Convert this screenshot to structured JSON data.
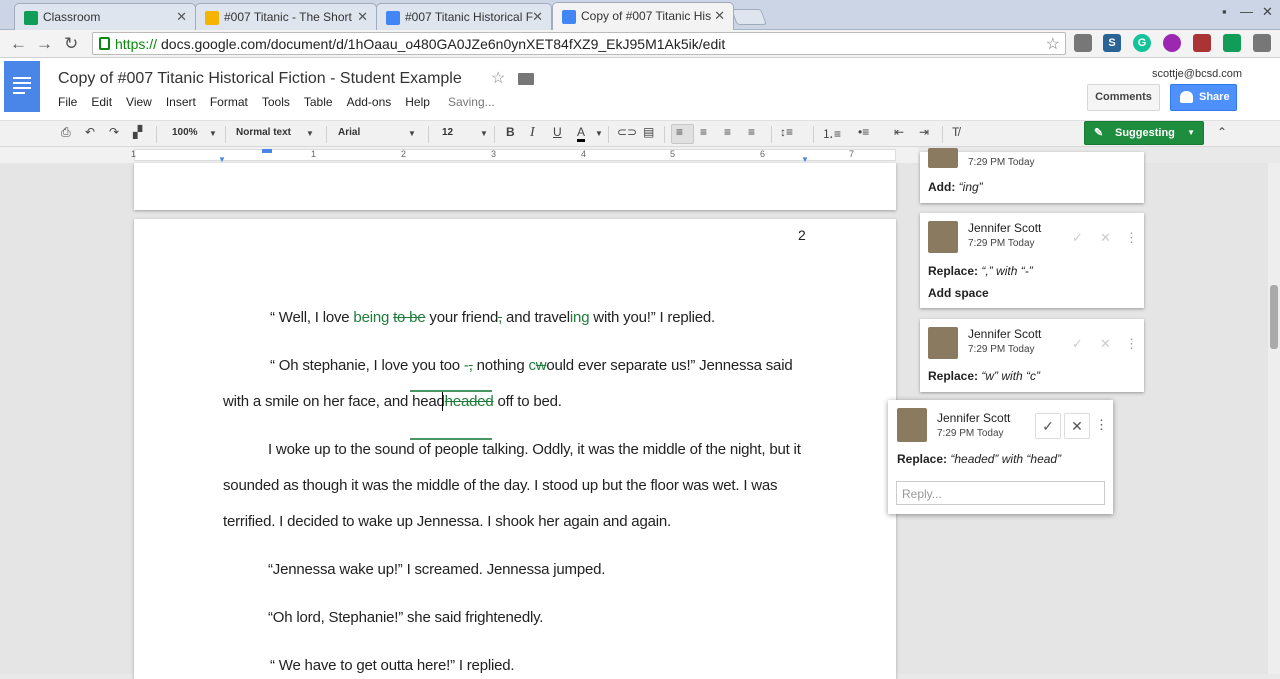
{
  "browser": {
    "tabs": [
      {
        "title": "Classroom",
        "icon": "classroom-icon",
        "color": "#0f9d58"
      },
      {
        "title": "#007 Titanic - The Short",
        "icon": "drive-icon",
        "color": "#f4b400"
      },
      {
        "title": "#007 Titanic Historical F",
        "icon": "docs-icon",
        "color": "#4285f4"
      },
      {
        "title": "Copy of #007 Titanic His",
        "icon": "docs-icon",
        "color": "#4285f4"
      }
    ],
    "url_scheme": "https://",
    "url_rest": "docs.google.com/document/d/1hOaau_o480GA0JZe6n0ynXET84fXZ9_EkJ95M1Ak5ik/edit",
    "extensions": [
      {
        "icon": "cast-icon",
        "label": "",
        "color": "#777"
      },
      {
        "icon": "s-icon",
        "label": "S",
        "color": "#2a6496"
      },
      {
        "icon": "grammarly-icon",
        "label": "G",
        "color": "#15c39a"
      },
      {
        "icon": "circle-icon",
        "label": "",
        "color": "#9c27b0"
      },
      {
        "icon": "bookmark-icon",
        "label": "",
        "color": "#a33"
      },
      {
        "icon": "classroom-ext-icon",
        "label": "",
        "color": "#0f9d58"
      },
      {
        "icon": "menu-icon",
        "label": "",
        "color": "#777"
      }
    ]
  },
  "docs": {
    "title": "Copy of #007 Titanic Historical Fiction - Student Example",
    "menu": [
      "File",
      "Edit",
      "View",
      "Insert",
      "Format",
      "Tools",
      "Table",
      "Add-ons",
      "Help"
    ],
    "status": "Saving...",
    "user_email": "scottje@bcsd.com",
    "comments_label": "Comments",
    "share_label": "Share",
    "toolbar": {
      "zoom": "100%",
      "style": "Normal text",
      "font": "Arial",
      "size": "12",
      "mode_label": "Suggesting"
    },
    "ruler_numbers": [
      "1",
      "1",
      "2",
      "3",
      "4",
      "5",
      "6",
      "7"
    ],
    "page_number": "2",
    "lines": {
      "l1a": "“ Well, I love ",
      "l1b": "being",
      "l1c": " ",
      "l1d": "to be",
      "l1e": " your friend",
      "l1f": ",",
      "l1g": " and travel",
      "l1h": "ing",
      "l1i": " with you!” I replied.",
      "l2a": "“ Oh stephanie, I love you too ",
      "l2b": "-",
      "l2c": ",",
      "l2d": " nothing ",
      "l2e": "c",
      "l2f": "w",
      "l2g": "ould ever separate us!” Jennessa said",
      "l3a": "with a smile on her face, and head",
      "l3b": "headed",
      "l3c": " off to bed.",
      "l4": "I woke up to the sound of people talking. Oddly, it was the middle of the night, but it",
      "l5": "sounded as though it was the middle of the day. I stood up but the floor was wet. I was",
      "l6": "terrified. I decided to wake up Jennessa. I shook her again and again.",
      "l7": "“Jennessa wake up!” I screamed. Jennessa jumped.",
      "l8": "“Oh lord, Stephanie!” she said frightenedly.",
      "l9": "“ We have to get outta here!” I replied."
    },
    "suggestions": [
      {
        "time": "7:29 PM Today",
        "action": "Add:",
        "detail": "“ing”"
      },
      {
        "name": "Jennifer Scott",
        "time": "7:29 PM Today",
        "action": "Replace:",
        "detail": "“,” with “-”",
        "extra": "Add space"
      },
      {
        "name": "Jennifer Scott",
        "time": "7:29 PM Today",
        "action": "Replace:",
        "detail": "“w” with “c”"
      }
    ],
    "active_suggestion": {
      "name": "Jennifer Scott",
      "time": "7:29 PM Today",
      "action": "Replace:",
      "detail": "“headed” with “head”",
      "reply_placeholder": "Reply..."
    }
  }
}
